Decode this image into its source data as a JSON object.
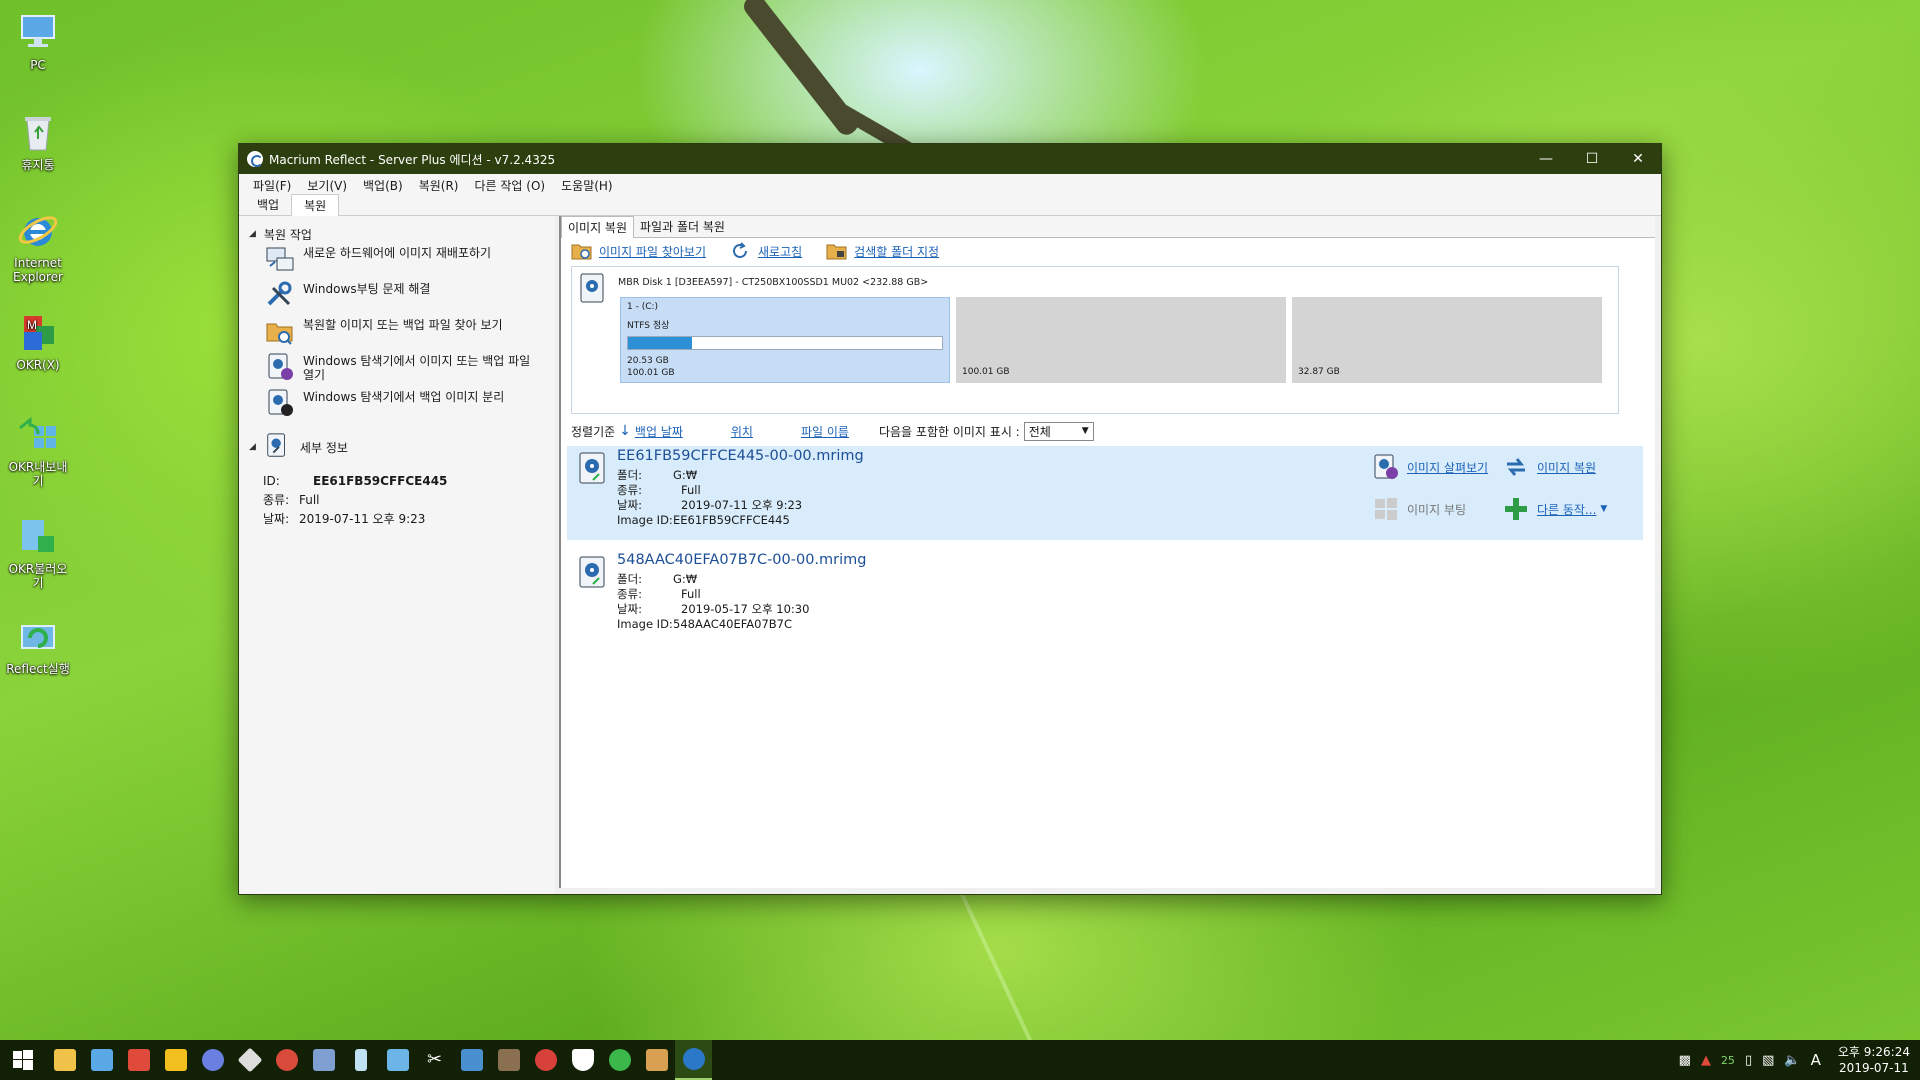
{
  "desktop": {
    "icons": [
      {
        "label": "PC"
      },
      {
        "label": "휴지통"
      },
      {
        "label": "Internet Explorer"
      },
      {
        "label": "OKR(X)"
      },
      {
        "label": "OKR내보내기"
      },
      {
        "label": "OKR불러오기"
      },
      {
        "label": "Reflect실행"
      }
    ]
  },
  "window": {
    "title": "Macrium Reflect - Server Plus 에디션 - v7.2.4325",
    "menu": [
      "파일(F)",
      "보기(V)",
      "백업(B)",
      "복원(R)",
      "다른 작업 (O)",
      "도움말(H)"
    ],
    "tabs": [
      "백업",
      "복원"
    ],
    "active_tab": "복원"
  },
  "left": {
    "section_restore": "복원 작업",
    "tasks": [
      "새로운 하드웨어에 이미지 재배포하기",
      "Windows부팅 문제 해결",
      "복원할 이미지 또는 백업 파일 찾아 보기",
      "Windows 탐색기에서 이미지 또는 백업 파일 열기",
      "Windows 탐색기에서 백업 이미지 분리"
    ],
    "section_details": "세부 정보",
    "details": {
      "id_label": "ID:",
      "id_value": "EE61FB59CFFCE445",
      "type_label": "종류:",
      "type_value": "Full",
      "date_label": "날짜:",
      "date_value": "2019-07-11 오후 9:23"
    }
  },
  "right": {
    "inner_tabs": [
      "이미지 복원",
      "파일과 폴더 복원"
    ],
    "toolbar": {
      "browse": "이미지 파일 찾아보기",
      "refresh": "새로고침",
      "folders": "검색할 폴더 지정"
    },
    "disk": {
      "title": "MBR Disk 1 [D3EEA597] - CT250BX100SSD1 MU02  <232.88 GB>",
      "partitions": [
        {
          "name": "1 - (C:)",
          "fs": "NTFS 정상",
          "used": "20.53 GB",
          "size": "100.01 GB",
          "fill": 0.205
        },
        {
          "size": "100.01 GB"
        },
        {
          "size": "32.87 GB"
        }
      ]
    },
    "sort": {
      "label": "정렬기준",
      "backup_date": "백업 날짜",
      "location": "위치",
      "file_name": "파일 이름",
      "show_label": "다음을 포함한 이미지 표시 :",
      "show_value": "전체"
    },
    "images": [
      {
        "file": "EE61FB59CFFCE445-00-00.mrimg",
        "folder_label": "폴더:",
        "folder": "G:₩",
        "type_label": "종류:",
        "type": "Full",
        "date_label": "날짜:",
        "date": "2019-07-11 오후 9:23",
        "id_label": "Image ID:",
        "id": "EE61FB59CFFCE445"
      },
      {
        "file": "548AAC40EFA07B7C-00-00.mrimg",
        "folder_label": "폴더:",
        "folder": "G:₩",
        "type_label": "종류:",
        "type": "Full",
        "date_label": "날짜:",
        "date": "2019-05-17 오후 10:30",
        "id_label": "Image ID:",
        "id": "548AAC40EFA07B7C"
      }
    ],
    "actions": {
      "browse_image": "이미지 살펴보기",
      "restore_image": "이미지 복원",
      "boot_image": "이미지 부팅",
      "other": "다른 동작..."
    }
  },
  "taskbar": {
    "tray_num": "25",
    "ime": "A",
    "time": "오후 9:26:24",
    "date": "2019-07-11"
  },
  "colors": {
    "titlebar": "#2d3f0e",
    "taskbar": "#122105",
    "link": "#1c63b8",
    "selected_row": "#d8ecfb",
    "progress": "#2d8fd6"
  }
}
